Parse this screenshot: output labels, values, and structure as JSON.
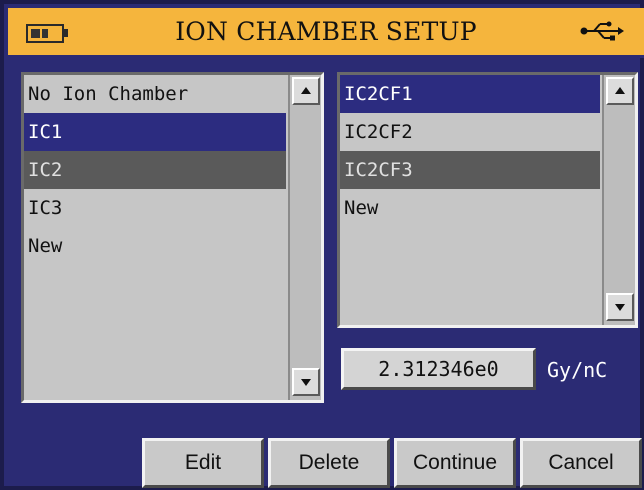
{
  "header": {
    "title": "ION CHAMBER SETUP",
    "battery_icon": "battery-icon",
    "usb_icon": "usb-icon",
    "accent_color": "#f5b53d"
  },
  "chamber_list": {
    "items": [
      "No Ion Chamber",
      "IC1",
      "IC2",
      "IC3",
      "New"
    ],
    "selected": "IC2"
  },
  "calibration_list": {
    "items": [
      "IC2CF1",
      "IC2CF2",
      "IC2CF3",
      "New"
    ],
    "selected": "IC2CF3"
  },
  "calibration": {
    "value": "2.312346e0",
    "unit": "Gy/nC"
  },
  "buttons": {
    "edit": "Edit",
    "delete": "Delete",
    "continue": "Continue",
    "cancel": "Cancel"
  },
  "colors": {
    "background": "#2b2b74",
    "list_bg": "#c6c6c6",
    "highlight_blue": "#2c2c80",
    "highlight_gray": "#5a5a5a"
  }
}
